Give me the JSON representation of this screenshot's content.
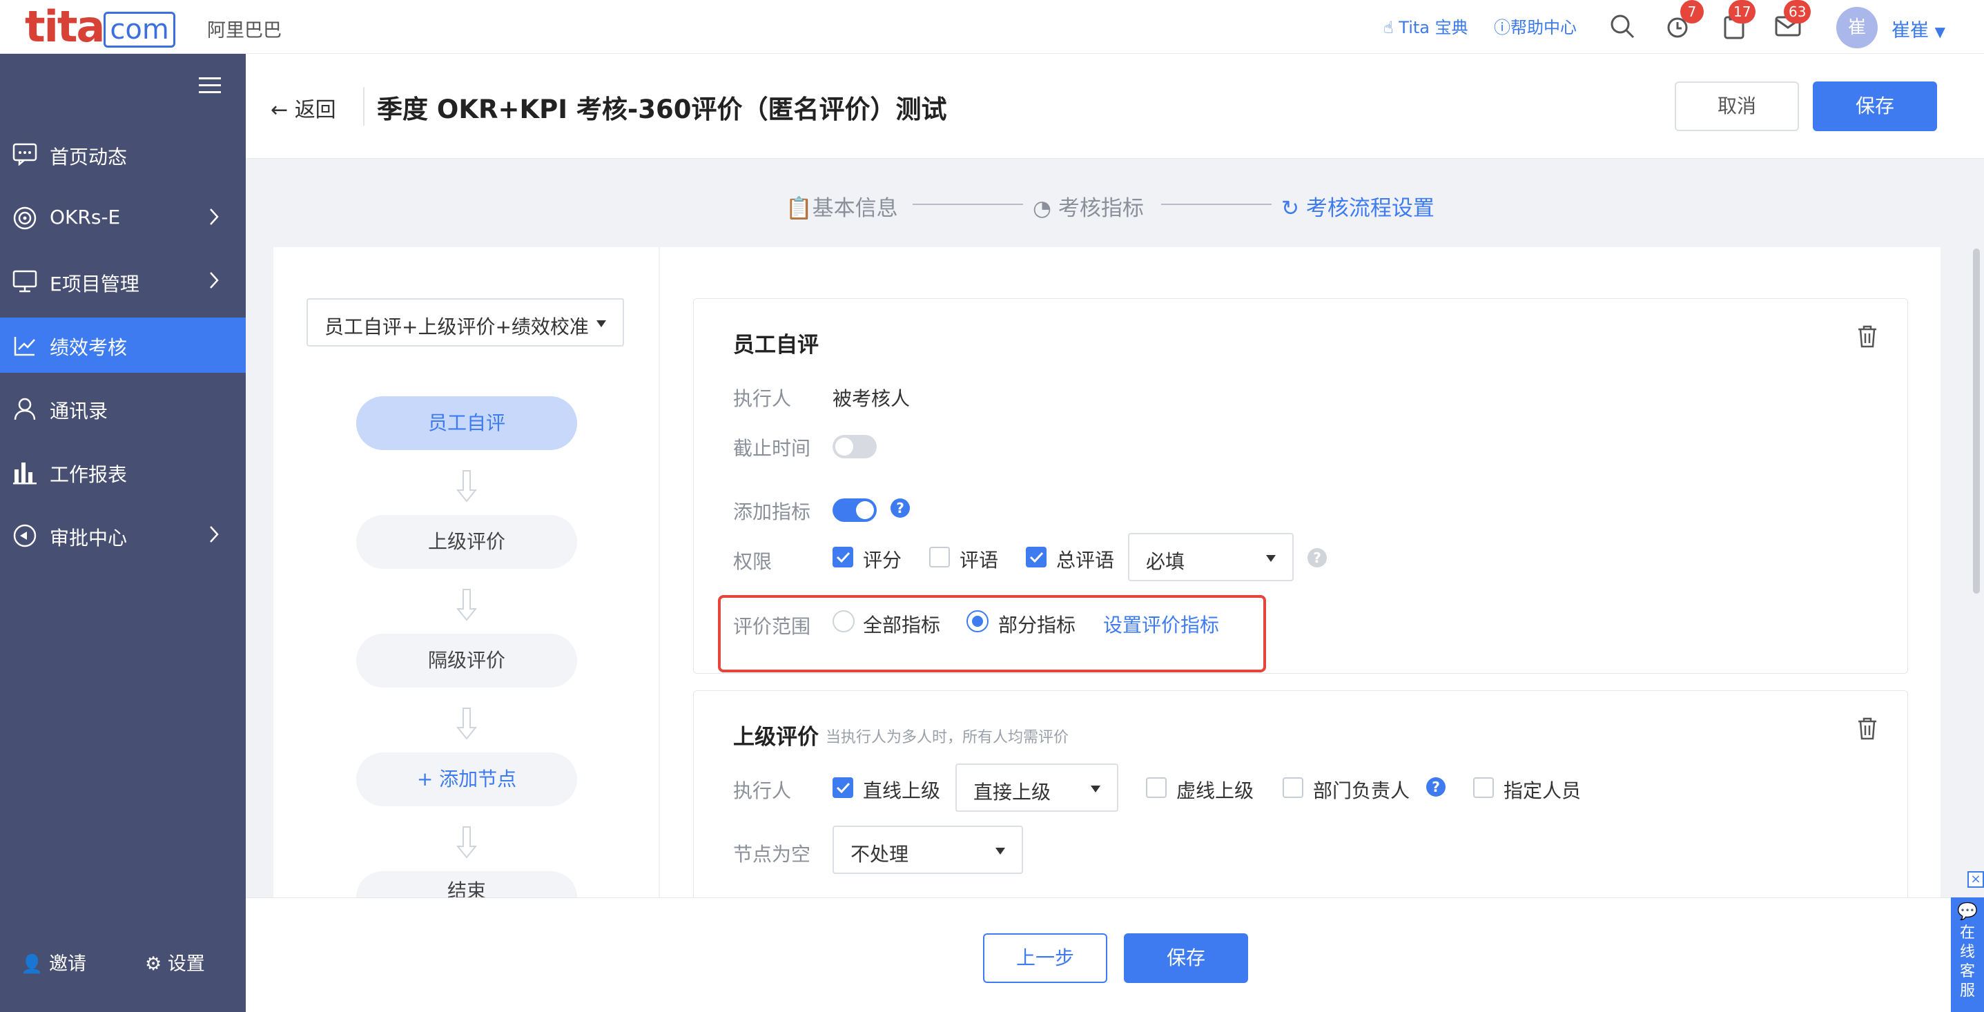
{
  "topbar": {
    "logo_main": "tita",
    "logo_suffix": "com",
    "org_name": "阿里巴巴",
    "links": {
      "tita_guide": "Tita 宝典",
      "help": "帮助中心"
    },
    "badges": {
      "reminders": "7",
      "tasks": "17",
      "messages": "63"
    },
    "avatar_initial": "崔",
    "user_name": "崔崔"
  },
  "sidebar": {
    "items": [
      {
        "label": "首页动态",
        "icon": "chat-bubble-icon"
      },
      {
        "label": "OKRs-E",
        "icon": "target-icon"
      },
      {
        "label": "E项目管理",
        "icon": "monitor-icon"
      },
      {
        "label": "绩效考核",
        "icon": "trend-chart-icon"
      },
      {
        "label": "通讯录",
        "icon": "user-icon"
      },
      {
        "label": "工作报表",
        "icon": "bar-chart-icon"
      },
      {
        "label": "审批中心",
        "icon": "approval-icon"
      }
    ],
    "invite": "邀请",
    "settings": "设置"
  },
  "header": {
    "back": "返回",
    "title": "季度 OKR+KPI 考核-360评价（匿名评价）测试",
    "cancel": "取消",
    "save": "保存"
  },
  "steps": [
    "基本信息",
    "考核指标",
    "考核流程设置"
  ],
  "flow": {
    "template": "员工自评+上级评价+绩效校准",
    "nodes": [
      "员工自评",
      "上级评价",
      "隔级评价",
      "+ 添加节点",
      "结束"
    ]
  },
  "self_eval": {
    "title": "员工自评",
    "executor_label": "执行人",
    "executor_value": "被考核人",
    "deadline_label": "截止时间",
    "add_metric_label": "添加指标",
    "permission_label": "权限",
    "perm_score": "评分",
    "perm_comment": "评语",
    "perm_overall": "总评语",
    "required_select": "必填",
    "scope_label": "评价范围",
    "scope_all": "全部指标",
    "scope_partial": "部分指标",
    "scope_link": "设置评价指标"
  },
  "superior_eval": {
    "title": "上级评价",
    "hint": "当执行人为多人时，所有人均需评价",
    "executor_label": "执行人",
    "direct_line": "直线上级",
    "direct_select": "直接上级",
    "dotted_line": "虚线上级",
    "dept_head": "部门负责人",
    "designated": "指定人员",
    "empty_label": "节点为空",
    "empty_select": "不处理"
  },
  "footer": {
    "prev": "上一步",
    "save": "保存"
  },
  "service": {
    "label": "在线客服"
  },
  "colors": {
    "primary": "#3e7bf0",
    "sidebar": "#474f72",
    "highlight": "#e5453b"
  }
}
